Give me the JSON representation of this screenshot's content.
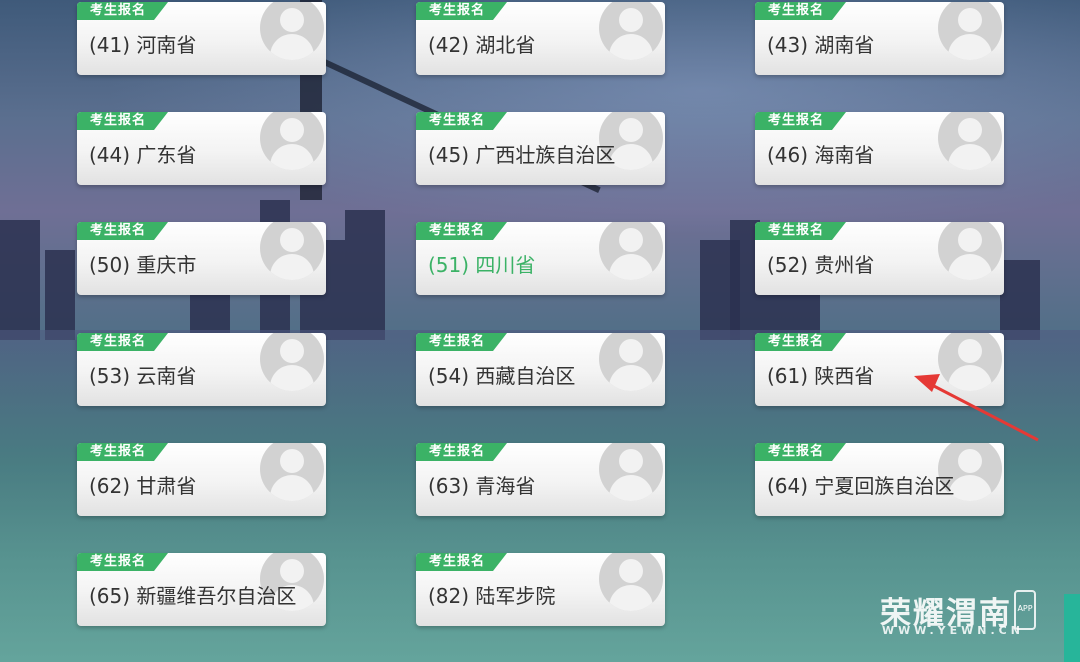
{
  "tag_label": "考生报名",
  "cards": [
    {
      "label": "(41) 河南省",
      "active": false
    },
    {
      "label": "(42) 湖北省",
      "active": false
    },
    {
      "label": "(43) 湖南省",
      "active": false
    },
    {
      "label": "(44) 广东省",
      "active": false
    },
    {
      "label": "(45) 广西壮族自治区",
      "active": false
    },
    {
      "label": "(46) 海南省",
      "active": false
    },
    {
      "label": "(50) 重庆市",
      "active": false
    },
    {
      "label": "(51) 四川省",
      "active": true
    },
    {
      "label": "(52) 贵州省",
      "active": false
    },
    {
      "label": "(53) 云南省",
      "active": false
    },
    {
      "label": "(54) 西藏自治区",
      "active": false
    },
    {
      "label": "(61) 陕西省",
      "active": false
    },
    {
      "label": "(62) 甘肃省",
      "active": false
    },
    {
      "label": "(63) 青海省",
      "active": false
    },
    {
      "label": "(64) 宁夏回族自治区",
      "active": false
    },
    {
      "label": "(65) 新疆维吾尔自治区",
      "active": false
    },
    {
      "label": "(82) 陆军步院",
      "active": false
    }
  ],
  "watermark": {
    "title": "荣耀渭南",
    "url": "WWW.YEWN.CN",
    "app": "APP"
  },
  "colors": {
    "tag_green": "#3bb266",
    "active_text": "#3bb266",
    "arrow_red": "#e53935"
  }
}
